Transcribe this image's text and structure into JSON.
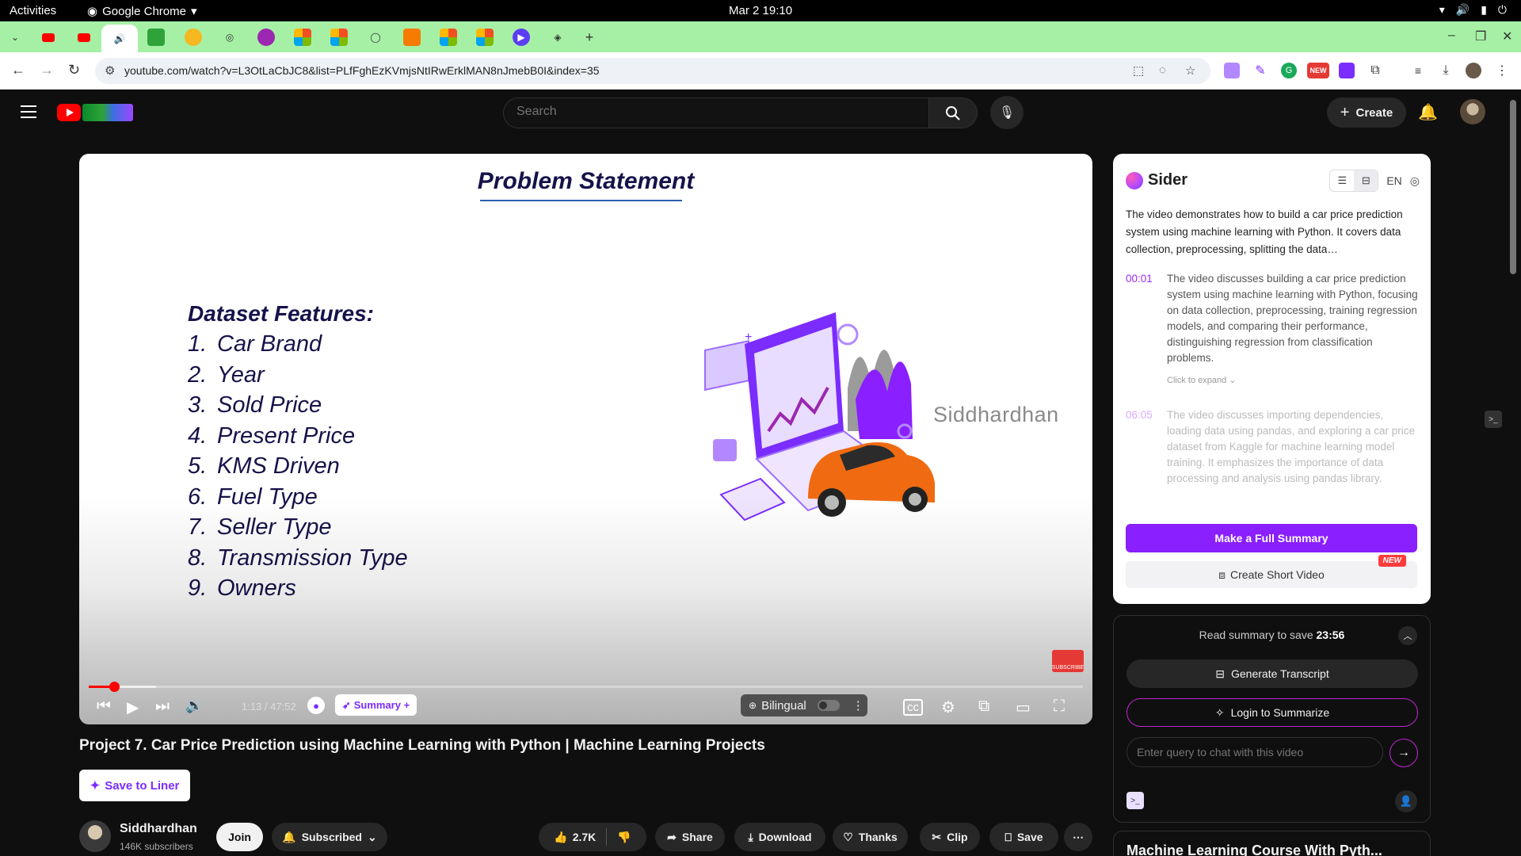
{
  "system": {
    "activities": "Activities",
    "app_name": "Google Chrome",
    "clock": "Mar 2  19:10"
  },
  "browser": {
    "url": "youtube.com/watch?v=L3OtLaCbJC8&list=PLfFghEzKVmjsNtIRwErklMAN8nJmebB0I&index=35",
    "new_badge": "NEW"
  },
  "youtube": {
    "search_placeholder": "Search",
    "create_label": "Create"
  },
  "slide": {
    "title": "Problem Statement",
    "features_heading": "Dataset Features:",
    "features": [
      {
        "n": "1.",
        "label": "Car Brand"
      },
      {
        "n": "2.",
        "label": "Year"
      },
      {
        "n": "3.",
        "label": "Sold Price"
      },
      {
        "n": "4.",
        "label": "Present Price"
      },
      {
        "n": "5.",
        "label": "KMS Driven"
      },
      {
        "n": "6.",
        "label": "Fuel Type"
      },
      {
        "n": "7.",
        "label": "Seller Type"
      },
      {
        "n": "8.",
        "label": "Transmission Type"
      },
      {
        "n": "9.",
        "label": "Owners"
      }
    ],
    "watermark": "Siddhardhan",
    "subscribe_label": "SUBSCRIBE"
  },
  "player": {
    "time": "1:13 / 47:52",
    "summary_label": "Summary +",
    "bilingual_label": "Bilingual",
    "progress_fraction": 0.0254
  },
  "video": {
    "title": "Project 7. Car Price Prediction using Machine Learning with Python | Machine Learning Projects",
    "save_to_liner": "Save to Liner",
    "channel_name": "Siddhardhan",
    "channel_subs": "146K subscribers",
    "join": "Join",
    "subscribed": "Subscribed",
    "likes": "2.7K",
    "share": "Share",
    "download": "Download",
    "thanks": "Thanks",
    "clip": "Clip",
    "save": "Save"
  },
  "sider": {
    "brand": "Sider",
    "lang": "EN",
    "intro": "The video demonstrates how to build a car price prediction system using machine learning with Python. It covers data collection, preprocessing, splitting the data…",
    "chapters": [
      {
        "ts": "00:01",
        "text": "The video discusses building a car price prediction system using machine learning with Python, focusing on data collection, preprocessing, training regression models, and comparing their performance, distinguishing regression from classification problems.",
        "more": "Click to expand ⌄"
      },
      {
        "ts": "06:05",
        "text": "The video discusses importing dependencies, loading data using pandas, and exploring a car price dataset from Kaggle for machine learning model training. It emphasizes the importance of data processing and analysis using pandas library."
      }
    ],
    "full_summary": "Make a Full Summary",
    "short_video": "Create Short Video",
    "new_tag": "NEW",
    "save_note_prefix": "Read summary to save",
    "save_note_time": "23:56",
    "generate_transcript": "Generate Transcript",
    "login_summarize": "Login to Summarize",
    "chat_placeholder": "Enter query to chat with this video"
  },
  "playlist": {
    "title": "Machine Learning Course With Pyth..."
  },
  "colors": {
    "accent_purple": "#8a1fff",
    "yt_red": "#ff0000",
    "tab_strip": "#a6f0a6"
  }
}
